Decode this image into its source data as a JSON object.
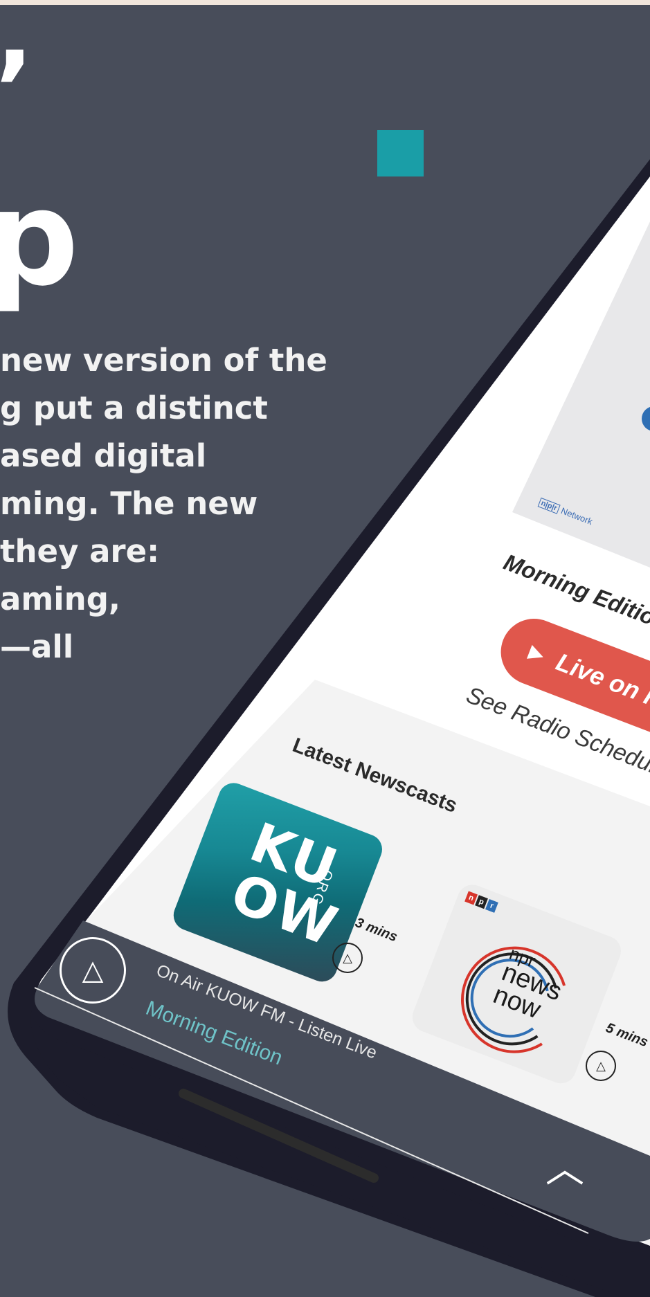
{
  "hero": {
    "quote_mark": "’",
    "headline_fragment": "p",
    "lines": [
      "new version of the",
      "g put a distinct",
      "ased digital",
      "ming. The new",
      " they are:",
      "aming,",
      "—all"
    ]
  },
  "phone": {
    "program_card": {
      "network_logo_box": "n|p|r",
      "network_logo_label": "Network",
      "program_title": "Morning Editio",
      "live_button_label": "Live on K",
      "schedule_link": "See Radio Schedul"
    },
    "newscasts": {
      "section_title": "Latest Newscasts",
      "items": [
        {
          "logo_text": [
            "KU",
            "OW"
          ],
          "logo_suffix": "ORG",
          "duration": "3 mins"
        },
        {
          "logo_badge": [
            "n",
            "p",
            "r"
          ],
          "logo_text": [
            "npr",
            "news",
            "now"
          ],
          "duration": "5 mins"
        }
      ]
    },
    "player": {
      "station_label": "On Air KUOW FM - Listen Live",
      "program_name": "Morning Edition"
    }
  },
  "colors": {
    "background": "#484d5a",
    "accent_teal": "#1a9ea7",
    "live_red": "#e0574c",
    "player_program": "#6fc3c8"
  }
}
